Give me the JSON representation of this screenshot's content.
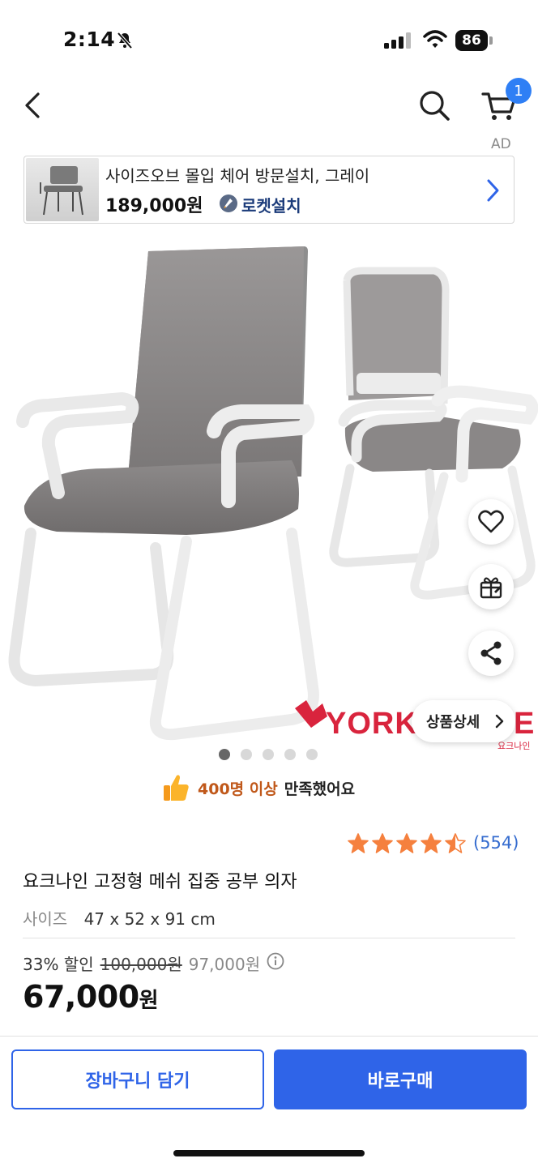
{
  "status_bar": {
    "time": "2:14",
    "battery": "86"
  },
  "nav": {
    "cart_count": "1"
  },
  "ad": {
    "label": "AD",
    "title": "사이즈오브 몰입 체어 방문설치, 그레이",
    "price": "189,000원",
    "badge": "로켓설치"
  },
  "gallery": {
    "brand": "YORK",
    "brand_tail": "E",
    "brand_sub": "요크나인",
    "detail_button": "상품상세",
    "dots": 5,
    "active_dot": 0
  },
  "satisfaction": {
    "highlight": "400명 이상",
    "text": "만족했어요"
  },
  "rating": {
    "stars": 4.5,
    "review_count": "(554)"
  },
  "product": {
    "title": "요크나인 고정형 메쉬 집중 공부 의자",
    "size_label": "사이즈",
    "size_value": "47 x 52 x 91 cm",
    "discount": "33% 할인",
    "original_price": "100,000원",
    "unit_price": "97,000원",
    "final_price": "67,000",
    "final_currency": "원"
  },
  "actions": {
    "add_to_cart": "장바구니 담기",
    "buy_now": "바로구매"
  },
  "colors": {
    "accent": "#2f64e8",
    "badge": "#2f7ff5",
    "star": "#f5803e",
    "review": "#356ccf",
    "brand": "#d9243d"
  }
}
